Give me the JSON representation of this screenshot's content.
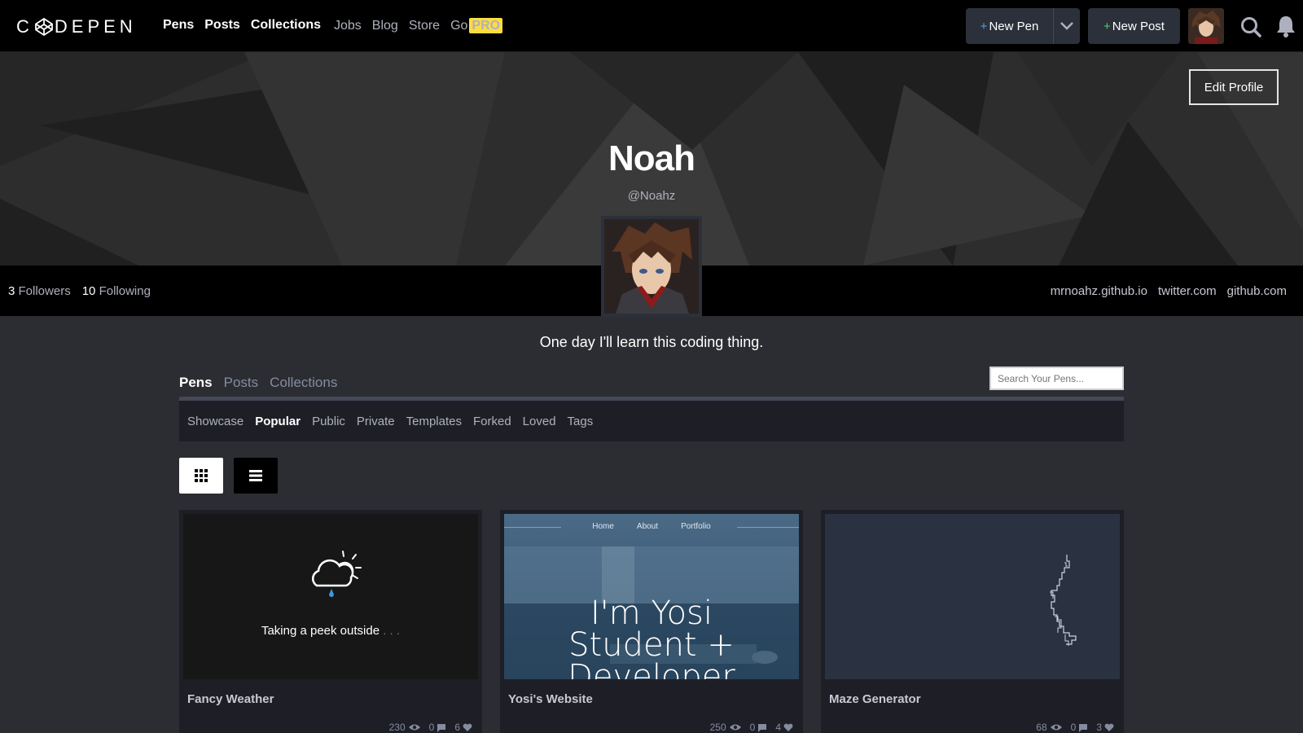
{
  "header": {
    "logo": "CODEPEN",
    "nav_main": [
      "Pens",
      "Posts",
      "Collections"
    ],
    "nav_secondary": [
      "Jobs",
      "Blog",
      "Store",
      "Go"
    ],
    "pro_badge": "PRO",
    "new_pen_label": "New Pen",
    "new_post_label": "New Post"
  },
  "profile": {
    "edit_label": "Edit Profile",
    "name": "Noah",
    "handle": "@Noahz",
    "followers_count": "3",
    "followers_label": "Followers",
    "following_count": "10",
    "following_label": "Following",
    "links": [
      "mrnoahz.github.io",
      "twitter.com",
      "github.com"
    ],
    "bio": "One day I'll learn this coding thing."
  },
  "tabs": {
    "items": [
      "Pens",
      "Posts",
      "Collections"
    ],
    "active": "Pens",
    "search_placeholder": "Search Your Pens..."
  },
  "subnav": {
    "items": [
      "Showcase",
      "Popular",
      "Public",
      "Private",
      "Templates",
      "Forked",
      "Loved",
      "Tags"
    ],
    "active": "Popular"
  },
  "pens": [
    {
      "title": "Fancy Weather",
      "views": "230",
      "comments": "0",
      "loves": "6",
      "preview_text": "Taking a peek outside",
      "preview_dots": ". . ."
    },
    {
      "title": "Yosi's Website",
      "views": "250",
      "comments": "0",
      "loves": "4",
      "preview_nav": [
        "Home",
        "About",
        "Portfolio"
      ],
      "preview_line1": "I'm Yosi",
      "preview_line2": "Student +",
      "preview_line3": "Developer"
    },
    {
      "title": "Maze Generator",
      "views": "68",
      "comments": "0",
      "loves": "3"
    }
  ],
  "colors": {
    "accent_green": "#47cf73",
    "pro_yellow": "#ffdd40",
    "page_bg": "#2c2d32"
  }
}
